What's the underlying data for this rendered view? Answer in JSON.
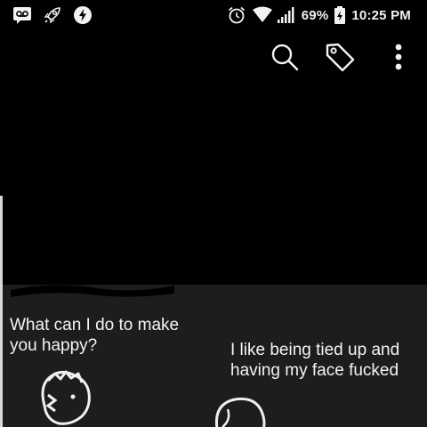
{
  "status_bar": {
    "battery_percent": "69%",
    "time": "10:25 PM",
    "left_icons": [
      "voicemail-icon",
      "rocket-icon",
      "lightning-icon"
    ],
    "right_icons": [
      "alarm-icon",
      "wifi-icon",
      "signal-icon",
      "battery-charging-icon"
    ]
  },
  "toolbar": {
    "actions": [
      "search-icon",
      "tag-icon",
      "more-vert-icon"
    ]
  },
  "image": {
    "caption_left": "What can I do to make you happy?",
    "caption_right": "I like being tied up and having my face fucked"
  },
  "colors": {
    "background": "#000000",
    "panel": "#1d1d1d",
    "icon": "#f2f2f2"
  }
}
